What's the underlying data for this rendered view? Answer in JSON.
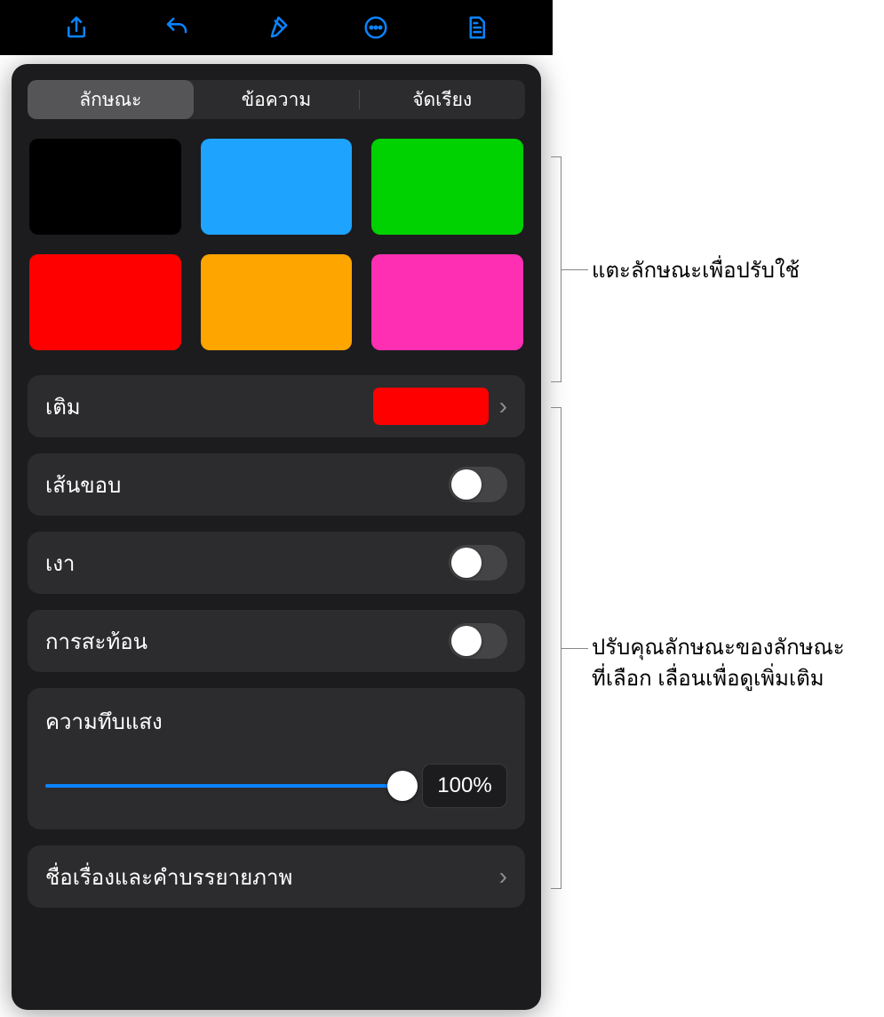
{
  "toolbar": {
    "share": "share-icon",
    "undo": "undo-icon",
    "format": "format-brush-icon",
    "more": "more-icon",
    "document": "document-settings-icon"
  },
  "tabs": {
    "style": "ลักษณะ",
    "text": "ข้อความ",
    "arrange": "จัดเรียง"
  },
  "swatches": [
    {
      "name": "black",
      "color": "#000000"
    },
    {
      "name": "blue",
      "color": "#1ea4ff"
    },
    {
      "name": "green",
      "color": "#00d100"
    },
    {
      "name": "red",
      "color": "#ff0000"
    },
    {
      "name": "orange",
      "color": "#ffa500"
    },
    {
      "name": "magenta",
      "color": "#ff2fb3"
    }
  ],
  "fill": {
    "label": "เติม",
    "color": "#ff0000"
  },
  "border": {
    "label": "เส้นขอบ",
    "on": false
  },
  "shadow": {
    "label": "เงา",
    "on": false
  },
  "reflection": {
    "label": "การสะท้อน",
    "on": false
  },
  "opacity": {
    "label": "ความทึบแสง",
    "value": 100,
    "display": "100%"
  },
  "title_caption": {
    "label": "ชื่อเรื่องและคำบรรยายภาพ"
  },
  "callouts": {
    "top": "แตะลักษณะเพื่อปรับใช้",
    "bottom_l1": "ปรับคุณลักษณะของลักษณะ",
    "bottom_l2": "ที่เลือก เลื่อนเพื่อดูเพิ่มเติม"
  }
}
